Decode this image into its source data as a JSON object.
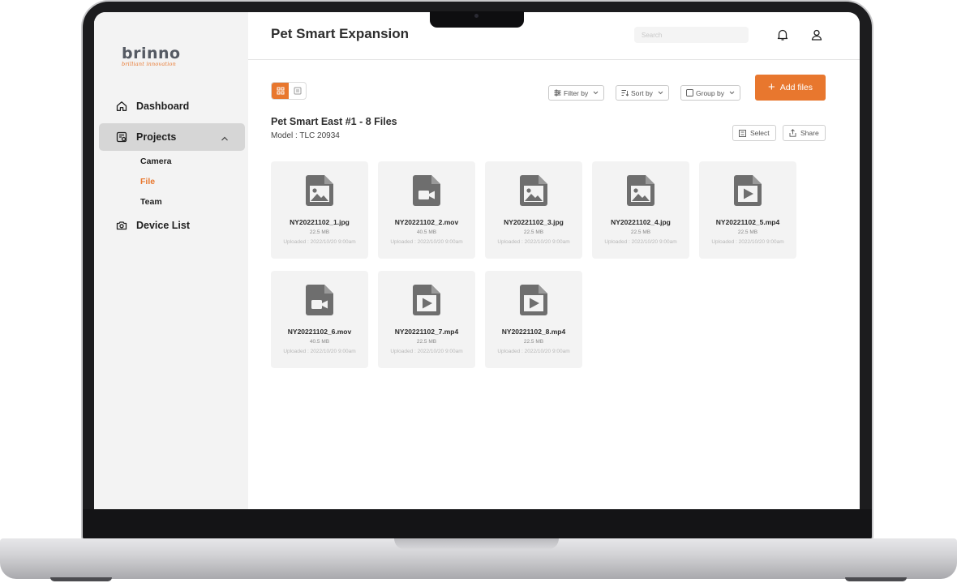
{
  "app": {
    "logo_text": "brinno",
    "logo_tagline": "brilliant innovation",
    "page_title": "Pet Smart Expansion",
    "search_placeholder": "Search",
    "accent_color": "#e8772e"
  },
  "sidebar": {
    "items": [
      {
        "label": "Dashboard",
        "icon": "home-icon"
      },
      {
        "label": "Projects",
        "icon": "projects-icon",
        "expanded": true
      },
      {
        "label": "Device List",
        "icon": "camera-icon"
      }
    ],
    "sub_items": [
      {
        "label": "Camera"
      },
      {
        "label": "File",
        "current": true
      },
      {
        "label": "Team"
      }
    ]
  },
  "toolbar": {
    "filter_label": "Filter by",
    "sort_label": "Sort by",
    "group_label": "Group by",
    "add_label": "Add files",
    "select_label": "Select",
    "share_label": "Share",
    "view_mode": "grid"
  },
  "folder": {
    "title": "Pet Smart East #1 - 8 Files",
    "model": "Model : TLC 20934"
  },
  "files": [
    {
      "name": "NY20221102_1.jpg",
      "size": "22.5 MB",
      "uploaded": "Uploaded : 2022/10/20 9:00am",
      "type": "image"
    },
    {
      "name": "NY20221102_2.mov",
      "size": "40.5 MB",
      "uploaded": "Uploaded : 2022/10/20 9:00am",
      "type": "video"
    },
    {
      "name": "NY20221102_3.jpg",
      "size": "22.5 MB",
      "uploaded": "Uploaded : 2022/10/20 9:00am",
      "type": "image"
    },
    {
      "name": "NY20221102_4.jpg",
      "size": "22.5 MB",
      "uploaded": "Uploaded : 2022/10/20 9:00am",
      "type": "image"
    },
    {
      "name": "NY20221102_5.mp4",
      "size": "22.5 MB",
      "uploaded": "Uploaded : 2022/10/20 9:00am",
      "type": "play"
    },
    {
      "name": "NY20221102_6.mov",
      "size": "40.5 MB",
      "uploaded": "Uploaded : 2022/10/20 9:00am",
      "type": "video"
    },
    {
      "name": "NY20221102_7.mp4",
      "size": "22.5 MB",
      "uploaded": "Uploaded : 2022/10/20 9:00am",
      "type": "play"
    },
    {
      "name": "NY20221102_8.mp4",
      "size": "22.5 MB",
      "uploaded": "Uploaded : 2022/10/20 9:00am",
      "type": "play"
    }
  ]
}
